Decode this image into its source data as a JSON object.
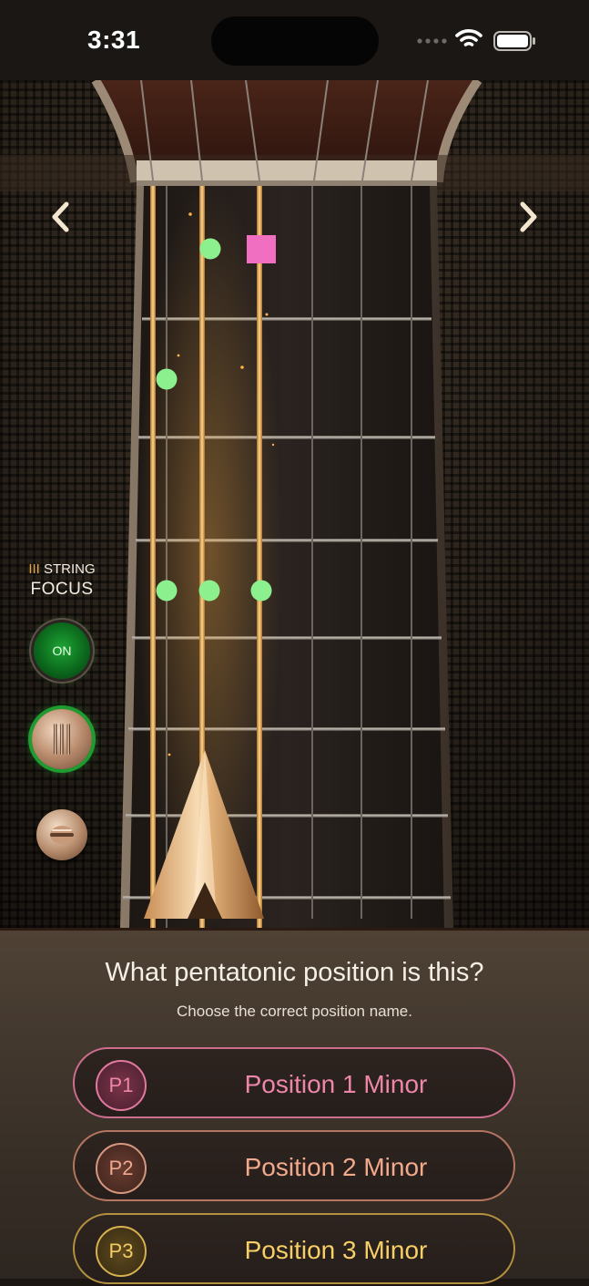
{
  "status_bar": {
    "time": "3:31"
  },
  "fretboard": {
    "focus_string_numeral": "III",
    "focus_string_word": "STRING",
    "focus_label": "FOCUS",
    "focus_toggle": "ON",
    "icons": {
      "prev": "chevron-left-icon",
      "next": "chevron-right-icon",
      "strings_mode": "strings-icon",
      "pick_mode": "pick-icon"
    },
    "note_color": "#8cf08e",
    "root_color": "#f06fc0",
    "highlight_string_color": "#e9b04c"
  },
  "quiz": {
    "question": "What pentatonic position is this?",
    "instruction": "Choose the correct position name.",
    "options": [
      {
        "badge": "P1",
        "label": "Position 1 Minor",
        "color": "#ee86ab"
      },
      {
        "badge": "P2",
        "label": "Position 2 Minor",
        "color": "#f2a98c"
      },
      {
        "badge": "P3",
        "label": "Position 3 Minor",
        "color": "#f6cf66"
      }
    ]
  }
}
